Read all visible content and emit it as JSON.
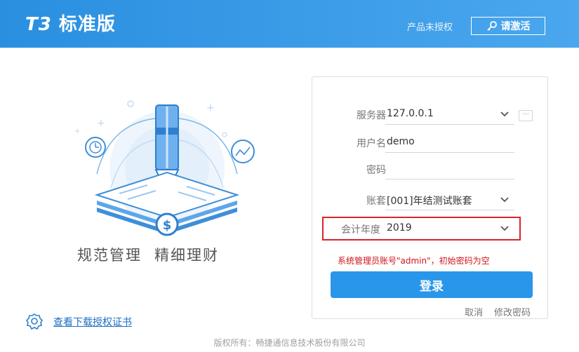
{
  "header": {
    "logo_mark": "T3",
    "logo_text": "标准版",
    "license_status": "产品未授权",
    "activate_label": "请激活"
  },
  "illustration": {
    "slogan_left": "规范管理",
    "slogan_right": "精细理财"
  },
  "license_link": {
    "label": "查看下载授权证书"
  },
  "login": {
    "server_label": "服务器",
    "server_value": "127.0.0.1",
    "server_more": "···",
    "user_label": "用户名",
    "user_value": "demo",
    "password_label": "密码",
    "password_value": "",
    "account_label": "账套",
    "account_value": "[001]年结测试账套",
    "year_label": "会计年度",
    "year_value": "2019",
    "hint": "系统管理员账号\"admin\"，初始密码为空",
    "login_button": "登录",
    "cancel_link": "取消",
    "change_password_link": "修改密码"
  },
  "footer": {
    "copyright": "版权所有：畅捷通信息技术股份有限公司"
  },
  "colors": {
    "header_blue": "#2a8fe0",
    "button_blue": "#2a96ea",
    "highlight_red": "#d9242a",
    "hint_red": "#d0141a"
  }
}
